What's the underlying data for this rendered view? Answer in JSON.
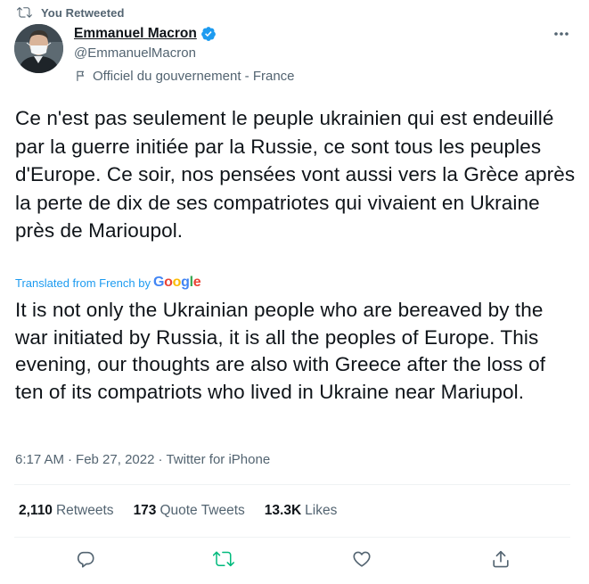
{
  "retweet_header": {
    "label": "You Retweeted"
  },
  "author": {
    "name": "Emmanuel Macron",
    "handle": "@EmmanuelMacron",
    "label": "Officiel du gouvernement - France"
  },
  "tweet": {
    "text": "Ce n'est pas seulement le peuple ukrainien qui est endeuillé par la guerre initiée par la Russie, ce sont tous les peuples d'Europe. Ce soir, nos pensées vont aussi vers la Grèce après la perte de dix de ses compatriotes qui vivaient en Ukraine près de Marioupol.",
    "translated_label": "Translated from French by",
    "translator": "Google",
    "translation": "It is not only the Ukrainian people who are bereaved by the war initiated by Russia, it is all the peoples of Europe. This evening, our thoughts are also with Greece after the loss of ten of its compatriots who lived in Ukraine near Mariupol.",
    "time": "6:17 AM",
    "date": "Feb 27, 2022",
    "source": "Twitter for iPhone",
    "separator": "·"
  },
  "stats": {
    "retweets_count": "2,110",
    "retweets_label": "Retweets",
    "quotes_count": "173",
    "quotes_label": "Quote Tweets",
    "likes_count": "13.3K",
    "likes_label": "Likes"
  },
  "icons": {
    "retweet_header": "retweet-icon",
    "verified": "verified-badge-icon",
    "label": "flag-icon",
    "more": "more-icon",
    "reply": "reply-icon",
    "retweet": "retweet-icon",
    "like": "heart-icon",
    "share": "share-icon"
  },
  "colors": {
    "accent": "#1d9bf0",
    "retweet_active": "#00ba7c",
    "secondary_text": "#536471",
    "primary_text": "#0f1419"
  }
}
